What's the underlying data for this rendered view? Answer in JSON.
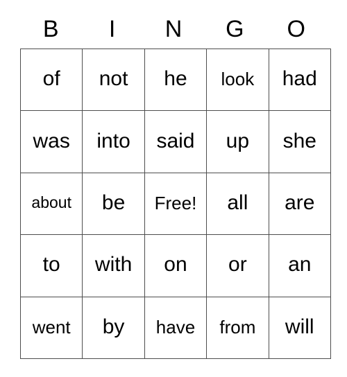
{
  "card": {
    "title_letters": [
      "B",
      "I",
      "N",
      "G",
      "O"
    ],
    "columns": 5,
    "rows": 5,
    "free_space_label": "Free!",
    "free_space_position": {
      "row": 2,
      "col": 2
    },
    "grid": [
      [
        "of",
        "not",
        "he",
        "look",
        "had"
      ],
      [
        "was",
        "into",
        "said",
        "up",
        "she"
      ],
      [
        "about",
        "be",
        "Free!",
        "all",
        "are"
      ],
      [
        "to",
        "with",
        "on",
        "or",
        "an"
      ],
      [
        "went",
        "by",
        "have",
        "from",
        "will"
      ]
    ],
    "colors": {
      "background": "#ffffff",
      "cell_background": "#ffffff",
      "border": "#4d4d4d",
      "text": "#000000"
    }
  }
}
